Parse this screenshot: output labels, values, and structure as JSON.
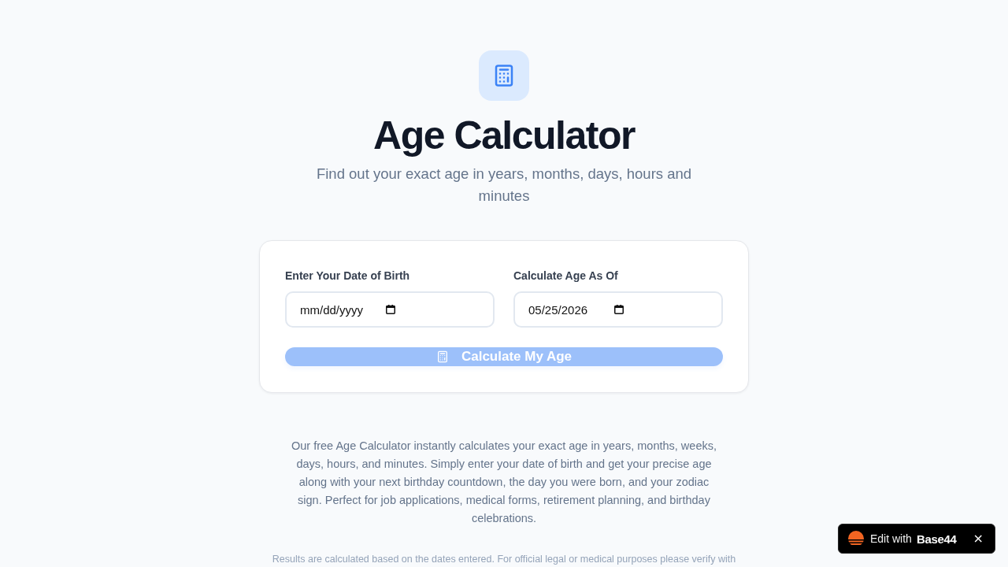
{
  "header": {
    "title": "Age Calculator",
    "subtitle": "Find out your exact age in years, months, days, hours and minutes"
  },
  "form": {
    "fields": [
      {
        "label": "Enter Your Date of Birth",
        "placeholder": "mm/dd/yyyy"
      },
      {
        "label": "Calculate Age As Of",
        "value": "05/25/2026"
      }
    ],
    "button": {
      "label": "Calculate My Age",
      "disabled": true
    }
  },
  "description": "Our free Age Calculator instantly calculates your exact age in years, months, weeks, days, hours, and minutes. Simply enter your date of birth and get your precise age along with your next birthday countdown, the day you were born, and your zodiac sign. Perfect for job applications, medical forms, retirement planning, and birthday celebrations.",
  "disclaimer": "Results are calculated based on the dates entered. For official legal or medical purposes please verify with",
  "badge": {
    "label": "Edit with",
    "brand": "Base44",
    "close": "×"
  }
}
